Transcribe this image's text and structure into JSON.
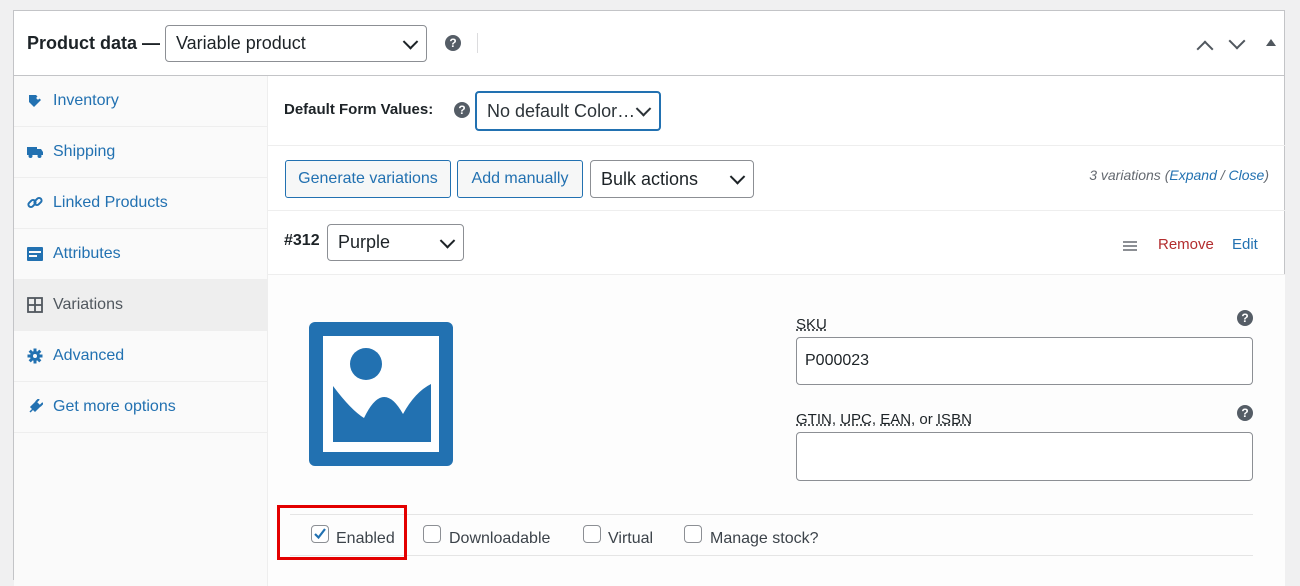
{
  "header": {
    "title": "Product data —",
    "product_type": "Variable product",
    "help": "?"
  },
  "sidebar": {
    "items": [
      {
        "label": "Inventory",
        "icon": "tag-icon"
      },
      {
        "label": "Shipping",
        "icon": "truck-icon"
      },
      {
        "label": "Linked Products",
        "icon": "link-icon"
      },
      {
        "label": "Attributes",
        "icon": "list-icon"
      },
      {
        "label": "Variations",
        "icon": "grid-icon",
        "active": true
      },
      {
        "label": "Advanced",
        "icon": "gear-icon"
      },
      {
        "label": "Get more options",
        "icon": "plugin-icon"
      }
    ]
  },
  "defaults": {
    "label": "Default Form Values:",
    "select_value": "No default Color…"
  },
  "toolbar": {
    "generate_label": "Generate variations",
    "add_label": "Add manually",
    "bulk_label": "Bulk actions",
    "count_text": "3 variations (",
    "expand": "Expand",
    "slash": " / ",
    "close": "Close",
    "close_paren": ")"
  },
  "variation": {
    "id": "#312",
    "attribute_value": "Purple",
    "remove_label": "Remove",
    "edit_label": "Edit",
    "sku_label": "SKU",
    "sku_value": "P000023",
    "gtin_label_parts": [
      "GTIN",
      ", ",
      "UPC",
      ", ",
      "EAN",
      ", or ",
      "ISBN"
    ],
    "gtin_value": "",
    "checkboxes": [
      {
        "label": "Enabled",
        "checked": true
      },
      {
        "label": "Downloadable",
        "checked": false
      },
      {
        "label": "Virtual",
        "checked": false
      },
      {
        "label": "Manage stock?",
        "checked": false
      }
    ]
  },
  "colors": {
    "accent": "#2271b1",
    "remove": "#b32d2e",
    "highlight": "#e30000"
  }
}
